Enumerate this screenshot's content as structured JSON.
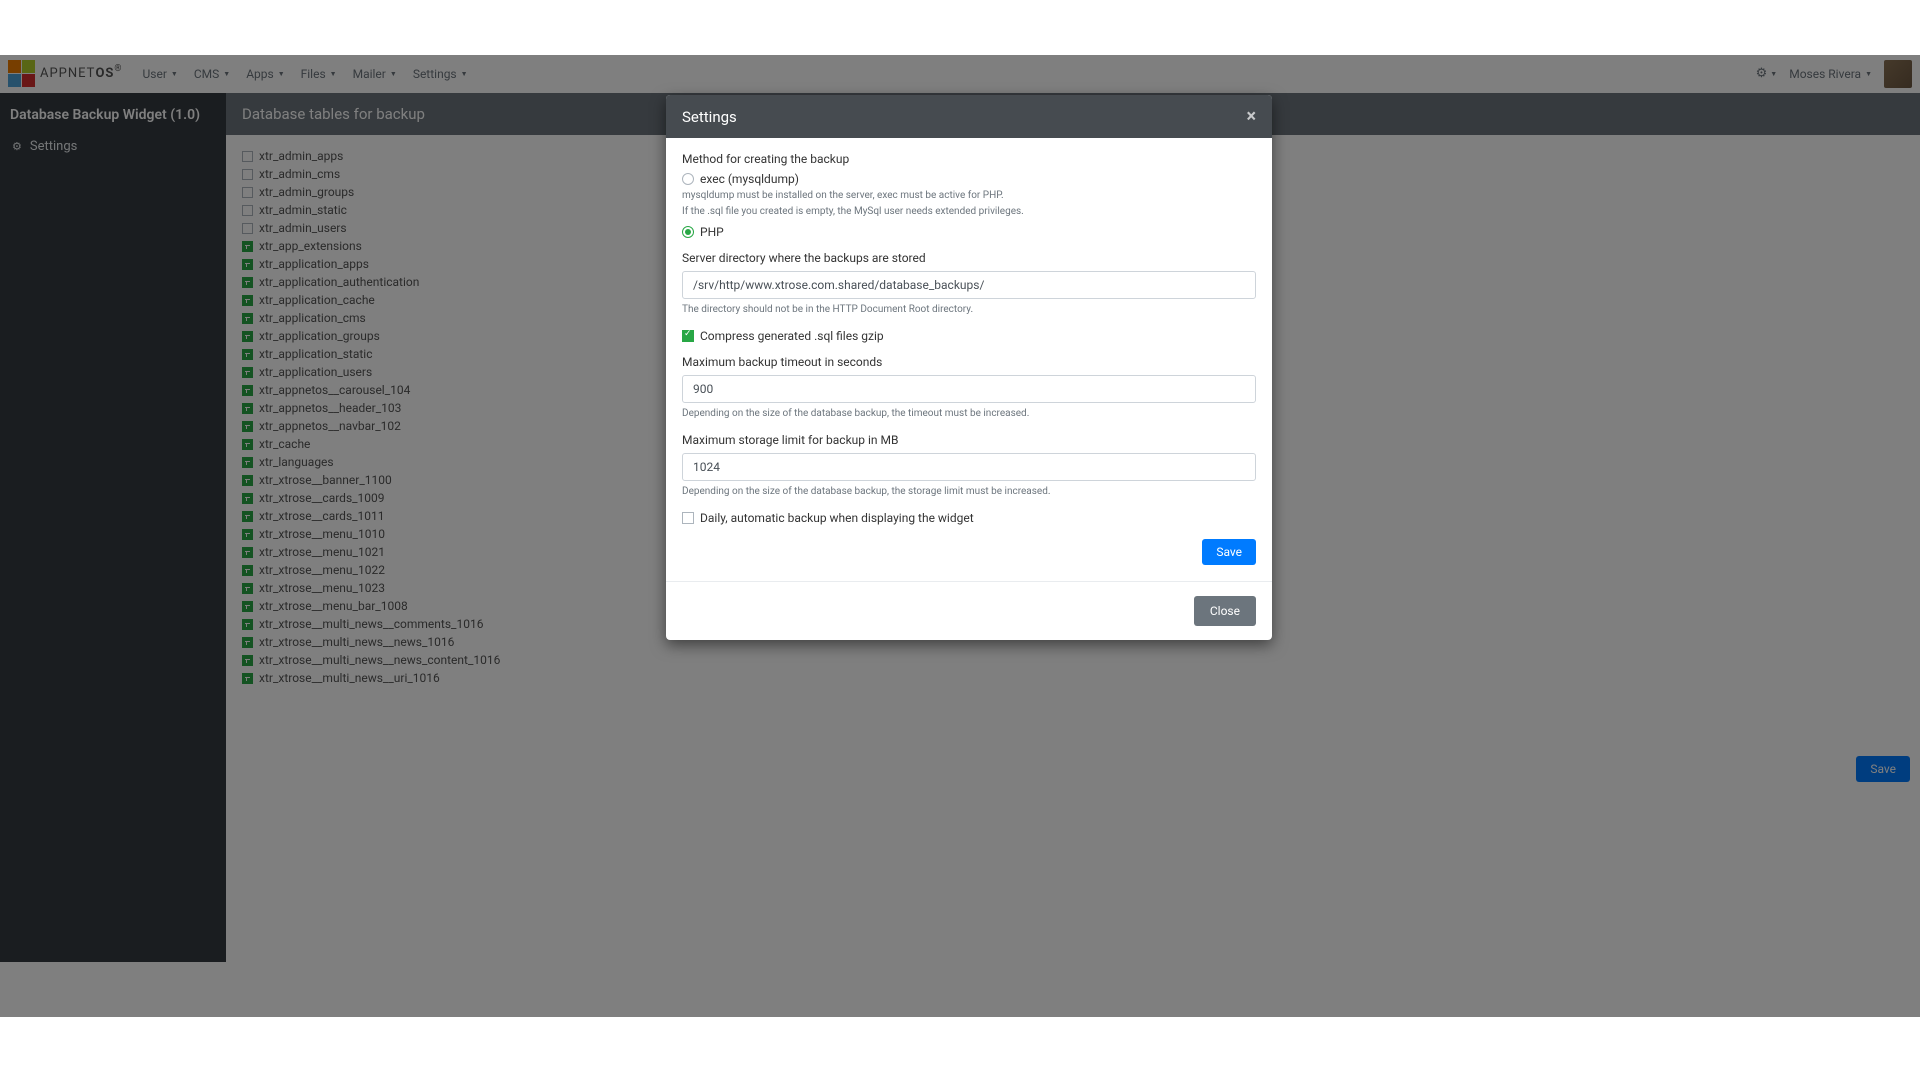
{
  "brand": {
    "light": "APPNET",
    "bold": "OS",
    "r": "®"
  },
  "nav": {
    "items": [
      "User",
      "CMS",
      "Apps",
      "Files",
      "Mailer",
      "Settings"
    ],
    "username": "Moses Rivera"
  },
  "sidebar": {
    "title": "Database Backup Widget (1.0)",
    "settings_label": "Settings"
  },
  "main": {
    "panel_title": "Database tables for backup",
    "tables": [
      {
        "name": "xtr_admin_apps",
        "checked": false
      },
      {
        "name": "xtr_admin_cms",
        "checked": false
      },
      {
        "name": "xtr_admin_groups",
        "checked": false
      },
      {
        "name": "xtr_admin_static",
        "checked": false
      },
      {
        "name": "xtr_admin_users",
        "checked": false
      },
      {
        "name": "xtr_app_extensions",
        "checked": true
      },
      {
        "name": "xtr_application_apps",
        "checked": true
      },
      {
        "name": "xtr_application_authentication",
        "checked": true
      },
      {
        "name": "xtr_application_cache",
        "checked": true
      },
      {
        "name": "xtr_application_cms",
        "checked": true
      },
      {
        "name": "xtr_application_groups",
        "checked": true
      },
      {
        "name": "xtr_application_static",
        "checked": true
      },
      {
        "name": "xtr_application_users",
        "checked": true
      },
      {
        "name": "xtr_appnetos__carousel_104",
        "checked": true
      },
      {
        "name": "xtr_appnetos__header_103",
        "checked": true
      },
      {
        "name": "xtr_appnetos__navbar_102",
        "checked": true
      },
      {
        "name": "xtr_cache",
        "checked": true
      },
      {
        "name": "xtr_languages",
        "checked": true
      },
      {
        "name": "xtr_xtrose__banner_1100",
        "checked": true
      },
      {
        "name": "xtr_xtrose__cards_1009",
        "checked": true
      },
      {
        "name": "xtr_xtrose__cards_1011",
        "checked": true
      },
      {
        "name": "xtr_xtrose__menu_1010",
        "checked": true
      },
      {
        "name": "xtr_xtrose__menu_1021",
        "checked": true
      },
      {
        "name": "xtr_xtrose__menu_1022",
        "checked": true
      },
      {
        "name": "xtr_xtrose__menu_1023",
        "checked": true
      },
      {
        "name": "xtr_xtrose__menu_bar_1008",
        "checked": true
      },
      {
        "name": "xtr_xtrose__multi_news__comments_1016",
        "checked": true
      },
      {
        "name": "xtr_xtrose__multi_news__news_1016",
        "checked": true
      },
      {
        "name": "xtr_xtrose__multi_news__news_content_1016",
        "checked": true
      },
      {
        "name": "xtr_xtrose__multi_news__uri_1016",
        "checked": true
      }
    ],
    "save_label": "Save"
  },
  "modal": {
    "title": "Settings",
    "method_label": "Method for creating the backup",
    "method_exec": "exec (mysqldump)",
    "method_exec_help1": "mysqldump must be installed on the server, exec must be active for PHP.",
    "method_exec_help2": "If the .sql file you created is empty, the MySql user needs extended privileges.",
    "method_php": "PHP",
    "dir_label": "Server directory where the backups are stored",
    "dir_value": "/srv/http/www.xtrose.com.shared/database_backups/",
    "dir_help": "The directory should not be in the HTTP Document Root directory.",
    "compress_label": "Compress generated .sql files gzip",
    "timeout_label": "Maximum backup timeout in seconds",
    "timeout_value": "900",
    "timeout_help": "Depending on the size of the database backup, the timeout must be increased.",
    "storage_label": "Maximum storage limit for backup in MB",
    "storage_value": "1024",
    "storage_help": "Depending on the size of the database backup, the storage limit must be increased.",
    "daily_label": "Daily, automatic backup when displaying the widget",
    "save_label": "Save",
    "close_label": "Close"
  }
}
